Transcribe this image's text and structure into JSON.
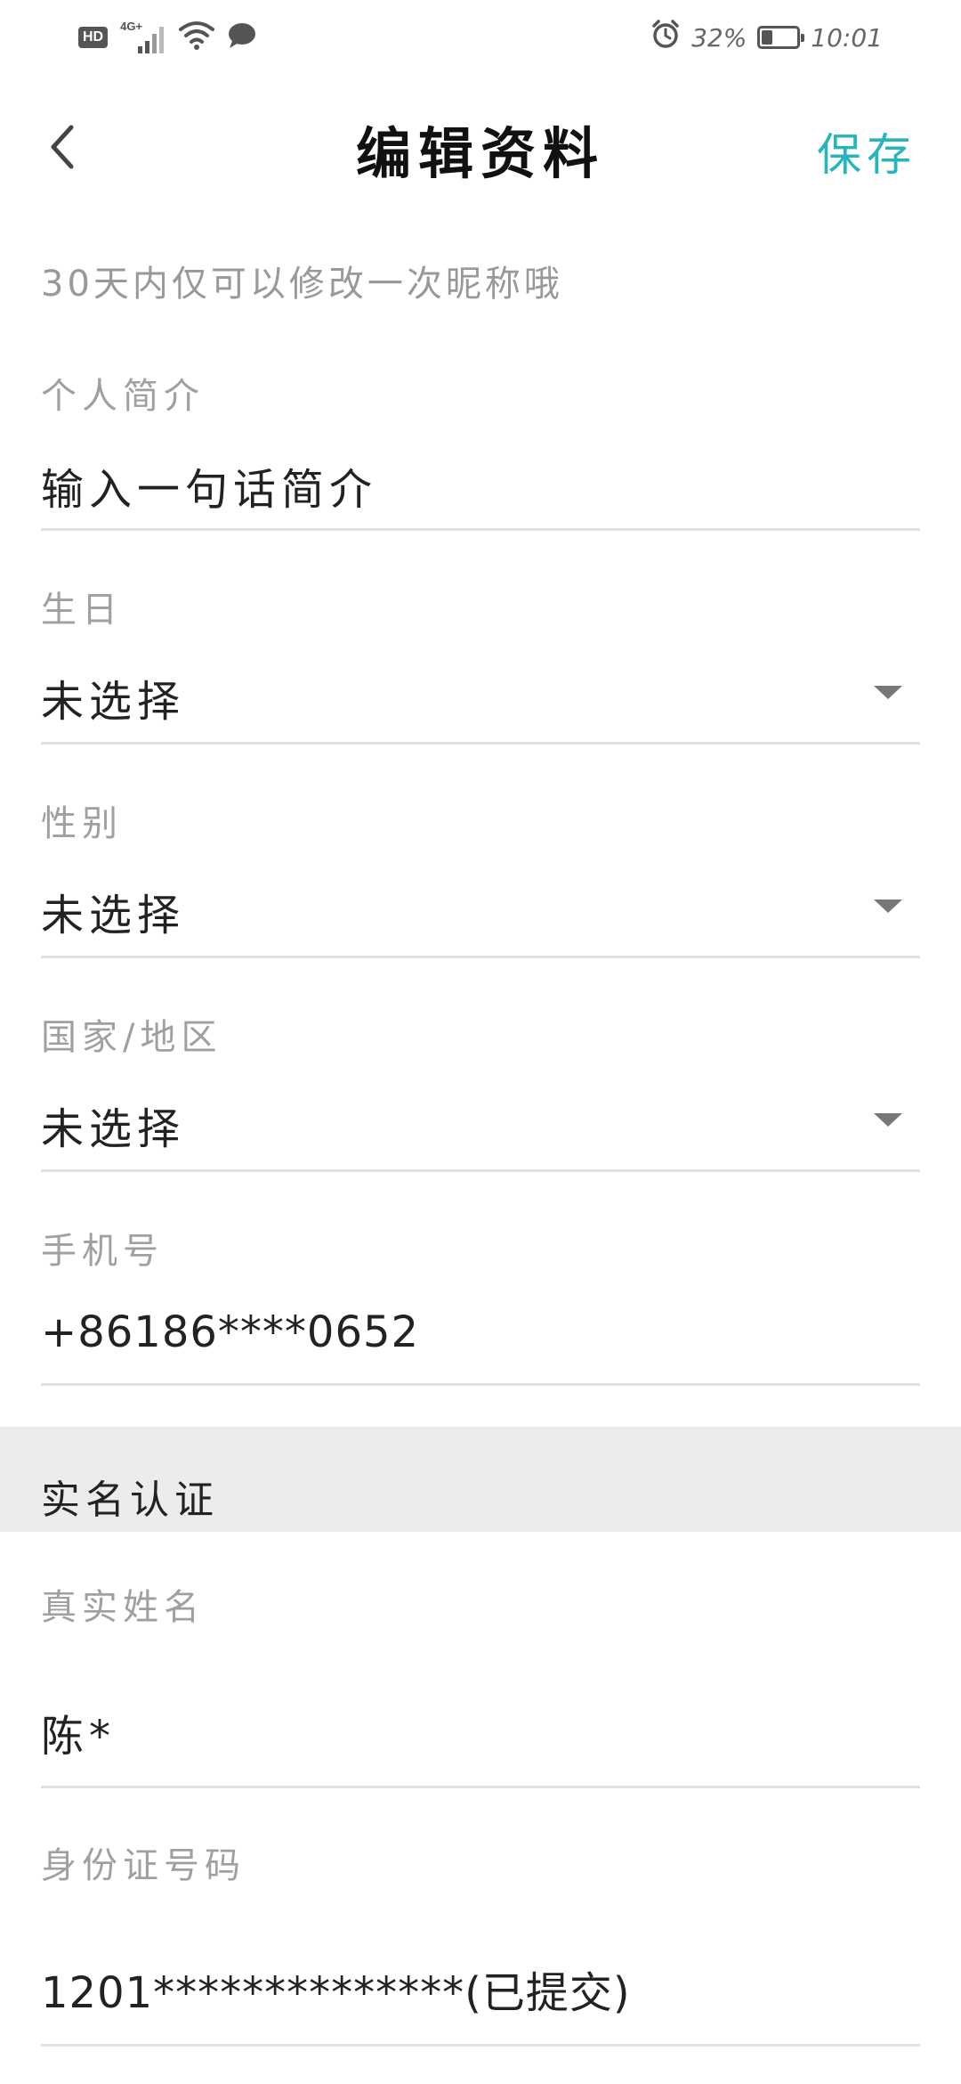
{
  "status_bar": {
    "hd": "HD",
    "network": "4G+",
    "battery": "32%",
    "battery_level": 0.32,
    "time": "10:01",
    "icons": [
      "signal-icon",
      "wifi-icon",
      "message-icon",
      "alarm-icon",
      "battery-icon"
    ]
  },
  "header": {
    "title": "编辑资料",
    "save_label": "保存",
    "back_icon": "chevron-left-icon",
    "accent_color": "#26b5bd"
  },
  "hint": "30天内仅可以修改一次昵称哦",
  "fields": {
    "bio": {
      "label": "个人简介",
      "placeholder": "输入一句话简介"
    },
    "birthday": {
      "label": "生日",
      "value": "未选择"
    },
    "gender": {
      "label": "性别",
      "value": "未选择"
    },
    "region": {
      "label": "国家/地区",
      "value": "未选择"
    },
    "phone": {
      "label": "手机号",
      "value": "+86186****0652"
    }
  },
  "verification": {
    "section_title": "实名认证",
    "real_name": {
      "label": "真实姓名",
      "value": "陈*"
    },
    "id_number": {
      "label": "身份证号码",
      "value": "1201**************(已提交)"
    }
  }
}
